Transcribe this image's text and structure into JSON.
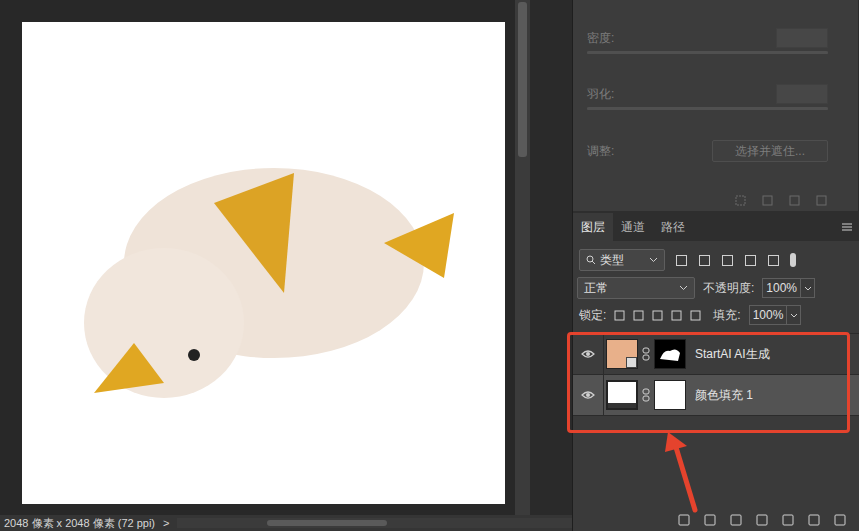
{
  "canvas": {
    "status": "2048 像素 x 2048 像素 (72 ppi)",
    "status_arrow": ">"
  },
  "properties": {
    "fields": [
      {
        "label": "密度:",
        "disabled": true,
        "level": 1
      },
      {
        "label": "羽化:",
        "disabled": true,
        "level": 1
      }
    ],
    "adjust_label": "调整:",
    "adjust_button": "选择并遮住..."
  },
  "panel_tabs": [
    {
      "label": "图层",
      "selected": true
    },
    {
      "label": "通道",
      "selected": false
    },
    {
      "label": "路径",
      "selected": false
    }
  ],
  "filter": {
    "value": "类型"
  },
  "blend_mode": "正常",
  "opacity_label": "不透明度:",
  "opacity": "100%",
  "lock_label": "锁定:",
  "fill_label": "填充:",
  "fill": "100%",
  "layers": [
    {
      "name": "StartAI AI生成",
      "visible": true,
      "selected": false,
      "kind": "smart"
    },
    {
      "name": "颜色填充 1",
      "visible": true,
      "selected": true,
      "kind": "fill"
    }
  ]
}
